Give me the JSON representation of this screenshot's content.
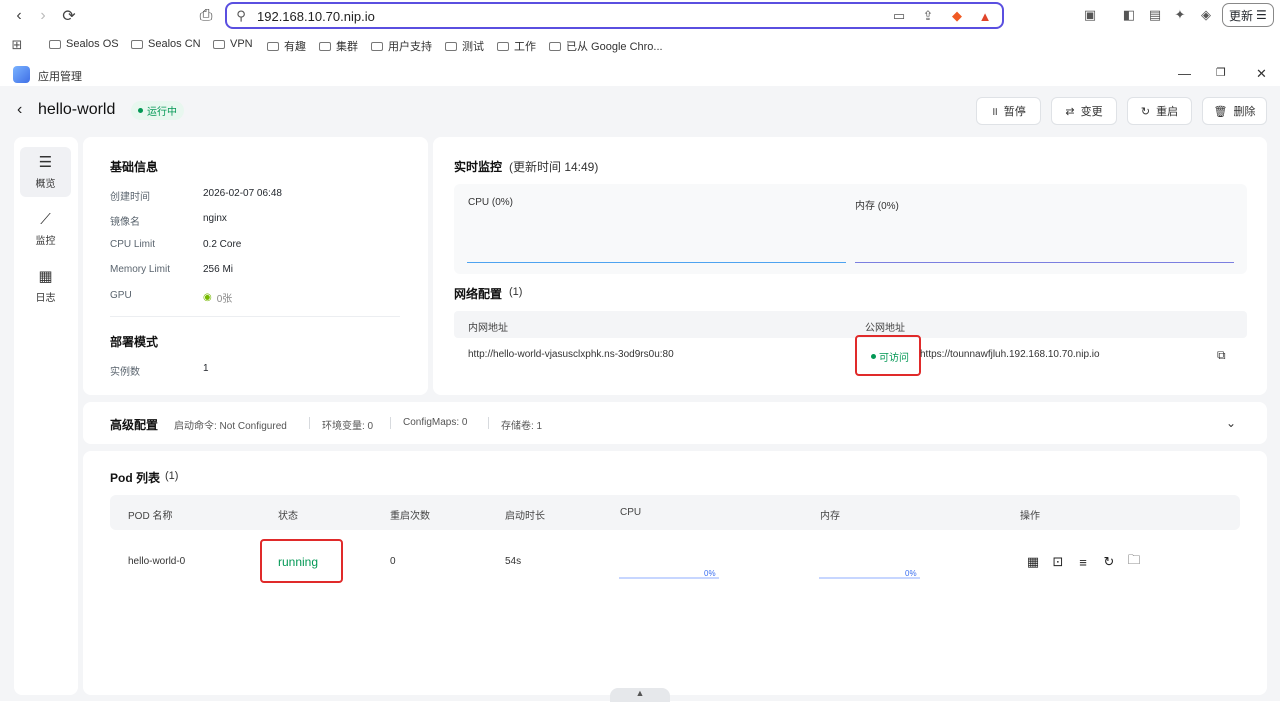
{
  "browser": {
    "url": "192.168.10.70.nip.io",
    "update_label": "更新",
    "bookmarks": [
      "Sealos OS",
      "Sealos CN",
      "VPN",
      "有趣",
      "集群",
      "用户支持",
      "测试",
      "工作",
      "已从 Google Chro..."
    ]
  },
  "window": {
    "app_name": "应用管理"
  },
  "header": {
    "app_title": "hello-world",
    "status": "运行中",
    "buttons": {
      "pause": "暂停",
      "change": "变更",
      "restart": "重启",
      "delete": "删除"
    }
  },
  "sidebar": {
    "items": [
      {
        "label": "概览"
      },
      {
        "label": "监控"
      },
      {
        "label": "日志"
      }
    ]
  },
  "basic": {
    "title": "基础信息",
    "rows": [
      {
        "k": "创建时间",
        "v": "2026-02-07 06:48"
      },
      {
        "k": "镜像名",
        "v": "nginx"
      },
      {
        "k": "CPU Limit",
        "v": "0.2 Core"
      },
      {
        "k": "Memory Limit",
        "v": "256 Mi"
      },
      {
        "k": "GPU",
        "v": "0张"
      }
    ],
    "deploy_title": "部署模式",
    "instances_k": "实例数",
    "instances_v": "1"
  },
  "monitor": {
    "title": "实时监控",
    "updated": "(更新时间  14:49)",
    "cpu_label": "CPU  (0%)",
    "mem_label": "内存  (0%)",
    "cpu_color": "#4ea3f0",
    "mem_color": "#7b7fe0"
  },
  "network": {
    "title": "网络配置",
    "count": "(1)",
    "col_internal": "内网地址",
    "col_public": "公网地址",
    "internal": "http://hello-world-vjasusclxphk.ns-3od9rs0u:80",
    "access": "可访问",
    "public": "https://tounnawfjluh.192.168.10.70.nip.io"
  },
  "advanced": {
    "title": "高级配置",
    "items": [
      "启动命令: Not Configured",
      "环境变量: 0",
      "ConfigMaps: 0",
      "存储卷: 1"
    ]
  },
  "pods": {
    "title": "Pod 列表",
    "count": "(1)",
    "headers": [
      "POD 名称",
      "状态",
      "重启次数",
      "启动时长",
      "CPU",
      "内存",
      "操作"
    ],
    "rows": [
      {
        "name": "hello-world-0",
        "status": "running",
        "restarts": "0",
        "uptime": "54s",
        "cpu": "0%",
        "mem": "0%"
      }
    ]
  }
}
